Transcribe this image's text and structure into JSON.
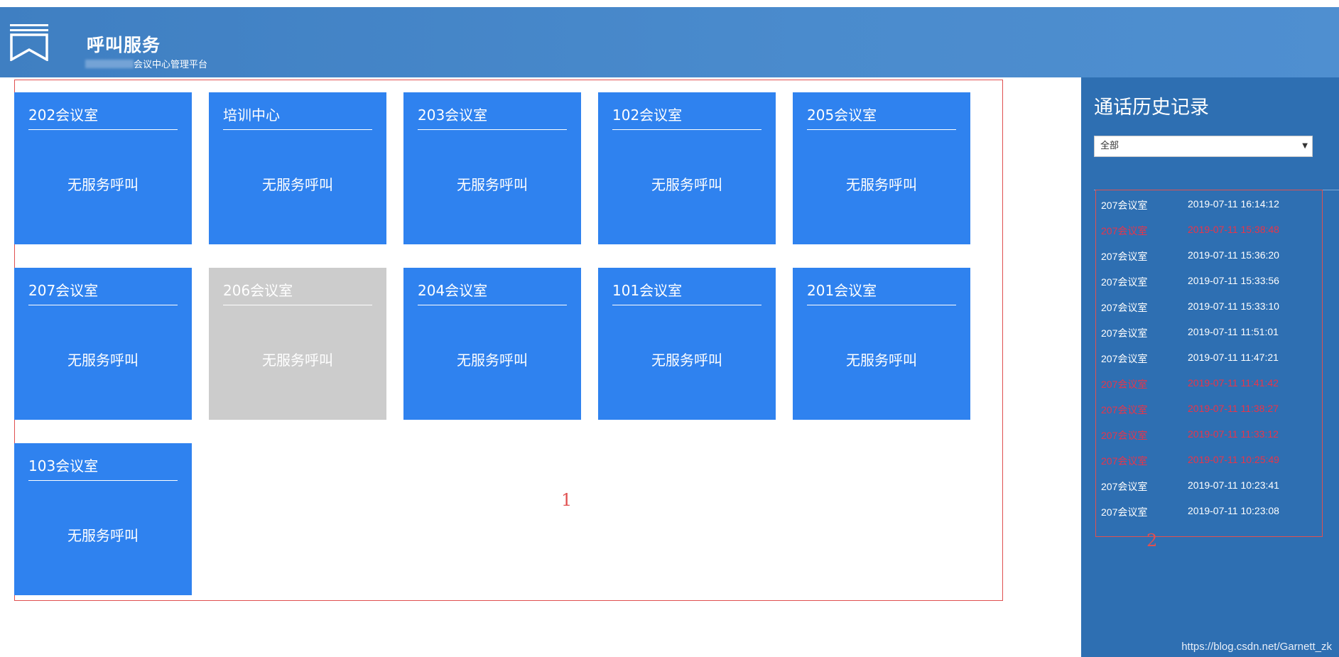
{
  "header": {
    "title": "呼叫服务",
    "subtitle": "会议中心管理平台",
    "logo_icon": "ribbon-bookmark-icon"
  },
  "main": {
    "region_label": "1",
    "rooms": [
      {
        "name": "202会议室",
        "status": "无服务呼叫",
        "available": true
      },
      {
        "name": "培训中心",
        "status": "无服务呼叫",
        "available": true
      },
      {
        "name": "203会议室",
        "status": "无服务呼叫",
        "available": true
      },
      {
        "name": "102会议室",
        "status": "无服务呼叫",
        "available": true
      },
      {
        "name": "205会议室",
        "status": "无服务呼叫",
        "available": true
      },
      {
        "name": "207会议室",
        "status": "无服务呼叫",
        "available": true
      },
      {
        "name": "206会议室",
        "status": "无服务呼叫",
        "available": false
      },
      {
        "name": "204会议室",
        "status": "无服务呼叫",
        "available": true
      },
      {
        "name": "101会议室",
        "status": "无服务呼叫",
        "available": true
      },
      {
        "name": "201会议室",
        "status": "无服务呼叫",
        "available": true
      },
      {
        "name": "103会议室",
        "status": "无服务呼叫",
        "available": true
      }
    ]
  },
  "sidebar": {
    "title": "通话历史记录",
    "filter": {
      "selected": "全部"
    },
    "region_label": "2",
    "history": [
      {
        "room": "207会议室",
        "time": "2019-07-11 16:14:12",
        "missed": false
      },
      {
        "room": "207会议室",
        "time": "2019-07-11 15:38:48",
        "missed": true
      },
      {
        "room": "207会议室",
        "time": "2019-07-11 15:36:20",
        "missed": false
      },
      {
        "room": "207会议室",
        "time": "2019-07-11 15:33:56",
        "missed": false
      },
      {
        "room": "207会议室",
        "time": "2019-07-11 15:33:10",
        "missed": false
      },
      {
        "room": "207会议室",
        "time": "2019-07-11 11:51:01",
        "missed": false
      },
      {
        "room": "207会议室",
        "time": "2019-07-11 11:47:21",
        "missed": false
      },
      {
        "room": "207会议室",
        "time": "2019-07-11 11:41:42",
        "missed": true
      },
      {
        "room": "207会议室",
        "time": "2019-07-11 11:38:27",
        "missed": true
      },
      {
        "room": "207会议室",
        "time": "2019-07-11 11:33:12",
        "missed": true
      },
      {
        "room": "207会议室",
        "time": "2019-07-11 10:25:49",
        "missed": true
      },
      {
        "room": "207会议室",
        "time": "2019-07-11 10:23:41",
        "missed": false
      },
      {
        "room": "207会议室",
        "time": "2019-07-11 10:23:08",
        "missed": false
      }
    ]
  },
  "watermark": "https://blog.csdn.net/Garnett_zk",
  "colors": {
    "header_bg": "#4a8bcd",
    "card_bg": "#2f82ef",
    "card_disabled_bg": "#cccccc",
    "sidebar_bg": "#2e6fb2",
    "missed_text": "#e8344a",
    "annotation_red": "#e05050"
  }
}
